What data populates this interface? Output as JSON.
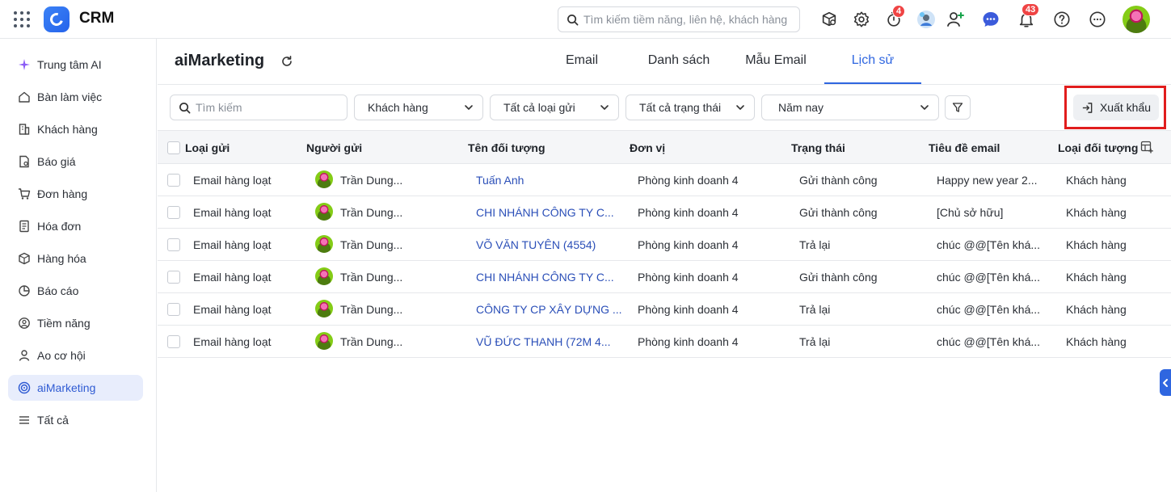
{
  "app": {
    "name": "CRM"
  },
  "topbar": {
    "search_placeholder": "Tìm kiếm tiềm năng, liên hệ, khách hàng",
    "timer_badge": "4",
    "notification_badge": "43"
  },
  "sidebar": {
    "items": [
      {
        "label": "Trung tâm AI",
        "icon": "sparkle-icon"
      },
      {
        "label": "Bàn làm việc",
        "icon": "home-icon"
      },
      {
        "label": "Khách hàng",
        "icon": "building-icon"
      },
      {
        "label": "Báo giá",
        "icon": "quote-document-icon"
      },
      {
        "label": "Đơn hàng",
        "icon": "cart-icon"
      },
      {
        "label": "Hóa đơn",
        "icon": "invoice-icon"
      },
      {
        "label": "Hàng hóa",
        "icon": "box-icon"
      },
      {
        "label": "Báo cáo",
        "icon": "pie-chart-icon"
      },
      {
        "label": "Tiềm năng",
        "icon": "prospect-icon"
      },
      {
        "label": "Ao cơ hội",
        "icon": "opportunity-icon"
      },
      {
        "label": "aiMarketing",
        "icon": "target-icon",
        "active": true
      },
      {
        "label": "Tất cả",
        "icon": "menu-icon"
      }
    ]
  },
  "main": {
    "title": "aiMarketing",
    "tabs": [
      {
        "label": "Email"
      },
      {
        "label": "Danh sách"
      },
      {
        "label": "Mẫu Email"
      },
      {
        "label": "Lịch sử",
        "active": true
      }
    ],
    "filters": {
      "search_placeholder": "Tìm kiếm",
      "object_type": "Khách hàng",
      "send_type": "Tất cả loại gửi",
      "status": "Tất cả trạng thái",
      "period": "Năm nay"
    },
    "export_label": "Xuất khẩu"
  },
  "table": {
    "columns": [
      "Loại gửi",
      "Người gửi",
      "Tên đối tượng",
      "Đơn vị",
      "Trạng thái",
      "Tiêu đề email",
      "Loại đối tượng"
    ],
    "rows": [
      [
        "Email hàng loạt",
        "Trần Dung...",
        "Tuấn Anh",
        "Phòng kinh doanh 4",
        "Gửi thành công",
        "Happy new year 2...",
        "Khách hàng"
      ],
      [
        "Email hàng loạt",
        "Trần Dung...",
        "CHI NHÁNH CÔNG TY C...",
        "Phòng kinh doanh 4",
        "Gửi thành công",
        "[Chủ sở hữu]",
        "Khách hàng"
      ],
      [
        "Email hàng loạt",
        "Trần Dung...",
        "VÕ VĂN TUYÊN (4554)",
        "Phòng kinh doanh 4",
        "Trả lại",
        "chúc @@[Tên khá...",
        "Khách hàng"
      ],
      [
        "Email hàng loạt",
        "Trần Dung...",
        "CHI NHÁNH CÔNG TY C...",
        "Phòng kinh doanh 4",
        "Gửi thành công",
        "chúc @@[Tên khá...",
        "Khách hàng"
      ],
      [
        "Email hàng loạt",
        "Trần Dung...",
        "CÔNG TY CP XÂY DỰNG ...",
        "Phòng kinh doanh 4",
        "Trả lại",
        "chúc @@[Tên khá...",
        "Khách hàng"
      ],
      [
        "Email hàng loạt",
        "Trần Dung...",
        "VŨ ĐỨC THANH (72M 4...",
        "Phòng kinh doanh 4",
        "Trả lại",
        "chúc @@[Tên khá...",
        "Khách hàng"
      ]
    ]
  },
  "colors": {
    "accent": "#2f66e0",
    "link": "#2b4fb8",
    "active_nav_bg": "#e8edfc",
    "badge": "#ef4444",
    "highlight_box": "#e11d1d"
  }
}
